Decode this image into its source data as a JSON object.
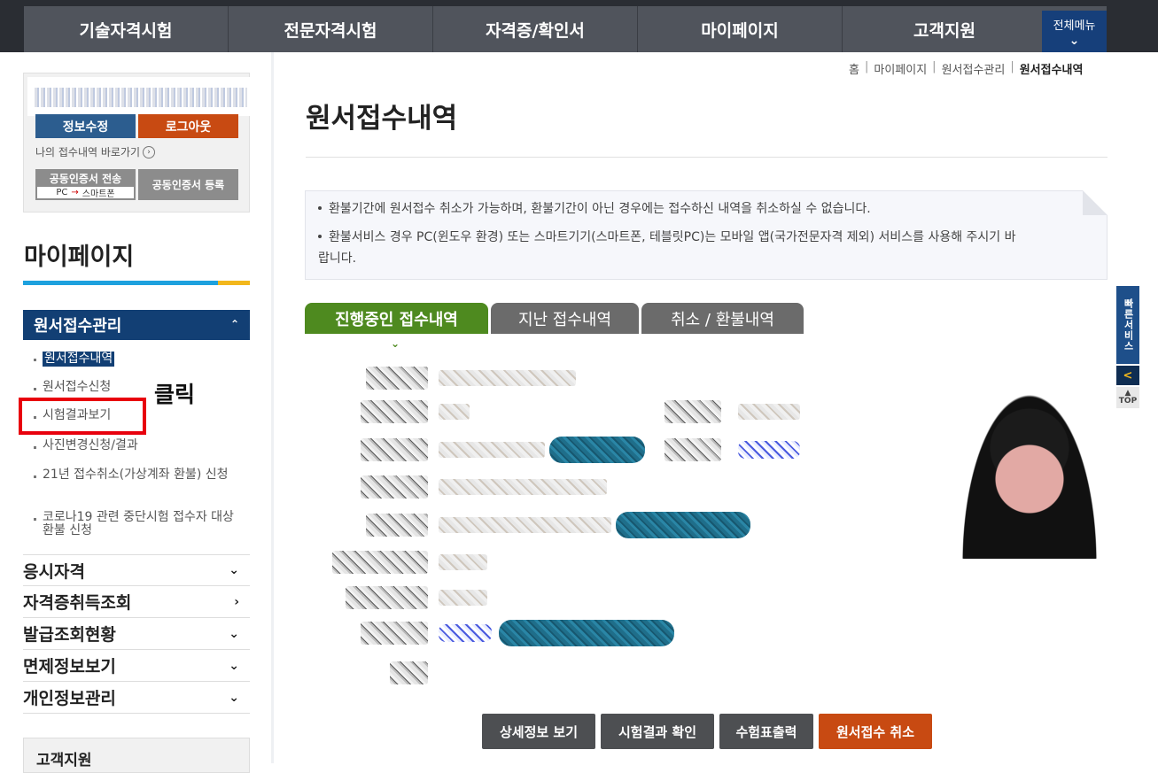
{
  "topnav": {
    "items": [
      "기술자격시험",
      "전문자격시험",
      "자격증/확인서",
      "마이페이지",
      "고객지원"
    ],
    "all_menu": "전체메뉴"
  },
  "userbox": {
    "edit_info": "정보수정",
    "logout": "로그아웃",
    "shortcut": "나의 접수내역 바로가기",
    "cert_send_line1": "공동인증서 전송",
    "cert_send_pc": "PC",
    "cert_send_phone": "스마트폰",
    "cert_register": "공동인증서 등록"
  },
  "sidebar": {
    "title": "마이페이지",
    "section": "원서접수관리",
    "subitems": [
      "원서접수내역",
      "원서접수신청",
      "시험결과보기",
      "사진변경신청/결과",
      "21년 접수취소(가상계좌 환불) 신청",
      "코로나19 관련 중단시험 접수자 대상 환불 신청"
    ],
    "annotation": "클릭",
    "menus": [
      "응시자격",
      "자격증취득조회",
      "발급조회현황",
      "면제정보보기",
      "개인정보관리"
    ],
    "support": "고객지원"
  },
  "breadcrumb": [
    "홈",
    "마이페이지",
    "원서접수관리",
    "원서접수내역"
  ],
  "page_title": "원서접수내역",
  "notice": {
    "line1": "환불기간에 원서접수 취소가 가능하며, 환불기간이 아닌 경우에는 접수하신 내역을 취소하실 수 없습니다.",
    "line2": "환불서비스 경우 PC(윈도우 환경) 또는 스마트기기(스마트폰, 테블릿PC)는 모바일 앱(국가전문자격 제외) 서비스를 사용해 주시기 바랍니다."
  },
  "tabs": [
    "진행중인 접수내역",
    "지난 접수내역",
    "취소 / 환불내역"
  ],
  "actions": [
    "상세정보 보기",
    "시험결과 확인",
    "수험표출력",
    "원서접수 취소"
  ],
  "quick": {
    "label": "빠른서비스",
    "collapse": "<",
    "top": "TOP"
  },
  "colors": {
    "nav_bg": "#50545c",
    "primary": "#123f74",
    "active_tab": "#4e8a1f",
    "cancel": "#c84a12",
    "highlight": "#e8000d"
  }
}
